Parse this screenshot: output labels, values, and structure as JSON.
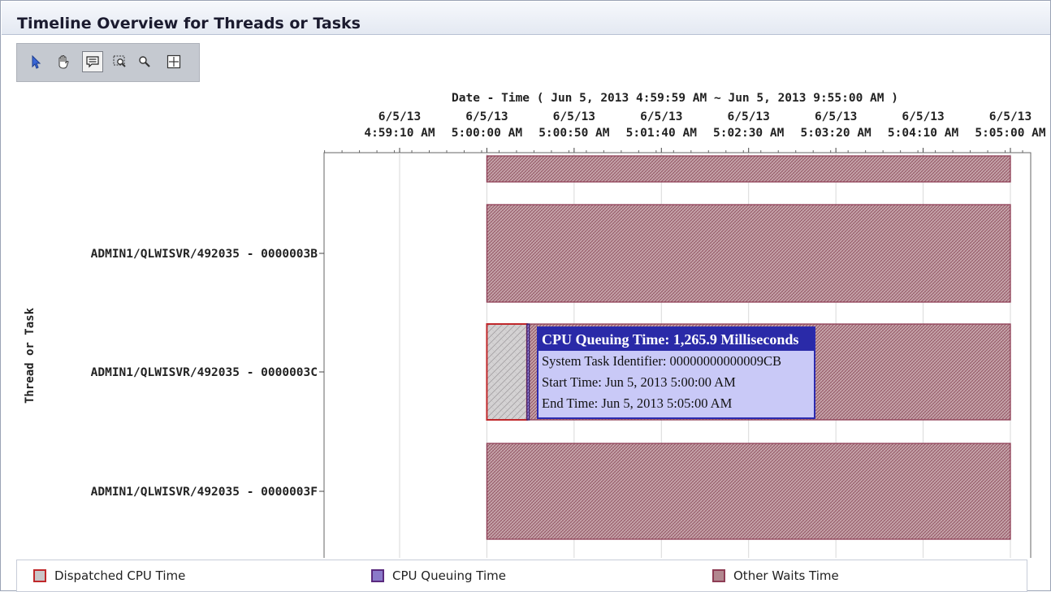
{
  "window": {
    "title": "Timeline Overview for Threads or Tasks"
  },
  "toolbar": {
    "tools": [
      {
        "name": "select-pointer",
        "icon": "arrow-pointer-icon"
      },
      {
        "name": "pan-hand",
        "icon": "hand-icon"
      },
      {
        "name": "info-tooltip",
        "icon": "speech-bubble-icon",
        "active": true
      },
      {
        "name": "zoom-box",
        "icon": "zoom-rect-icon"
      },
      {
        "name": "zoom-out",
        "icon": "magnifier-icon"
      },
      {
        "name": "fit-all",
        "icon": "crosshair-box-icon"
      }
    ]
  },
  "chart_data": {
    "type": "timeline",
    "title": "Date - Time ( Jun 5, 2013 4:59:59 AM ~ Jun 5, 2013 9:55:00 AM )",
    "ylabel": "Thread or Task",
    "x_unit": "seconds",
    "x_ticks": [
      {
        "value": 0,
        "date": "6/5/13",
        "time": "4:59:10 AM"
      },
      {
        "value": 50,
        "date": "6/5/13",
        "time": "5:00:00 AM"
      },
      {
        "value": 100,
        "date": "6/5/13",
        "time": "5:00:50 AM"
      },
      {
        "value": 150,
        "date": "6/5/13",
        "time": "5:01:40 AM"
      },
      {
        "value": 200,
        "date": "6/5/13",
        "time": "5:02:30 AM"
      },
      {
        "value": 250,
        "date": "6/5/13",
        "time": "5:03:20 AM"
      },
      {
        "value": 300,
        "date": "6/5/13",
        "time": "5:04:10 AM"
      },
      {
        "value": 350,
        "date": "6/5/13",
        "time": "5:05:00 AM"
      }
    ],
    "xlim": [
      -43,
      360
    ],
    "rows": [
      {
        "label": "",
        "segments": [
          {
            "type": "Other Waits Time",
            "start": 50,
            "end": 350
          }
        ]
      },
      {
        "label": "ADMIN1/QLWISVR/492035 - 0000003B",
        "segments": [
          {
            "type": "Other Waits Time",
            "start": 50,
            "end": 350
          }
        ]
      },
      {
        "label": "ADMIN1/QLWISVR/492035 - 0000003C",
        "segments": [
          {
            "type": "Dispatched CPU Time",
            "start": 50,
            "end": 73
          },
          {
            "type": "CPU Queuing Time",
            "start": 73,
            "end": 74.3
          },
          {
            "type": "Other Waits Time",
            "start": 74.3,
            "end": 350
          }
        ]
      },
      {
        "label": "ADMIN1/QLWISVR/492035 - 0000003F",
        "segments": [
          {
            "type": "Other Waits Time",
            "start": 50,
            "end": 350
          }
        ]
      }
    ],
    "legend": [
      {
        "name": "Dispatched CPU Time",
        "fill": "#c9c6c8",
        "stroke": "#c0282b"
      },
      {
        "name": "CPU Queuing Time",
        "fill": "#8a79c9",
        "stroke": "#5a2a7e"
      },
      {
        "name": "Other Waits Time",
        "fill": "#b2878f",
        "stroke": "#8e3d55"
      }
    ],
    "legend_position": "bottom"
  },
  "tooltip": {
    "title": "CPU Queuing Time: 1,265.9 Milliseconds",
    "lines": [
      "System Task Identifier: 00000000000009CB",
      "Start Time: Jun 5, 2013 5:00:00 AM",
      "End Time: Jun 5, 2013 5:05:00 AM"
    ]
  }
}
